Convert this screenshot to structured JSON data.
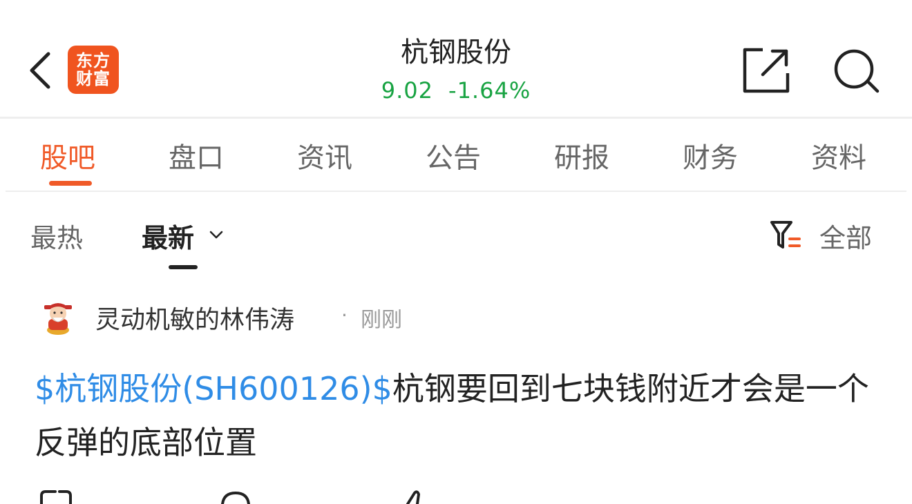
{
  "header": {
    "logo_line1": "东方",
    "logo_line2": "财富",
    "stock_name": "杭钢股份",
    "price": "9.02",
    "change": "-1.64%",
    "price_color": "#18a342",
    "icons": [
      "back-chevron-icon",
      "share-icon",
      "search-icon"
    ]
  },
  "tabs": [
    {
      "label": "股吧",
      "active": true
    },
    {
      "label": "盘口"
    },
    {
      "label": "资讯"
    },
    {
      "label": "公告"
    },
    {
      "label": "研报"
    },
    {
      "label": "财务"
    },
    {
      "label": "资料"
    }
  ],
  "sort": {
    "hot": "最热",
    "new": "最新",
    "filter_label": "全部"
  },
  "post": {
    "author": "灵动机敏的林伟涛",
    "separator": "·",
    "time": "刚刚",
    "mention": "$杭钢股份(SH600126)$",
    "text": "杭钢要回到七块钱附近才会是一个反弹的底部位置"
  },
  "colors": {
    "accent": "#f05a28",
    "link": "#2f8ce6",
    "down": "#18a342"
  }
}
